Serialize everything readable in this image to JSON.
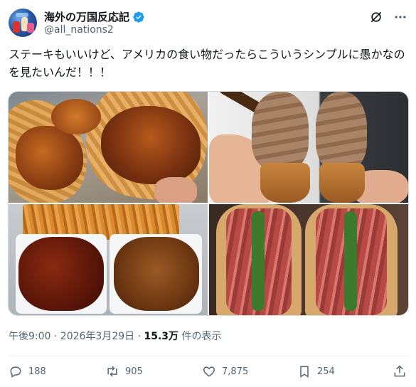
{
  "author": {
    "display_name": "海外の万国反応記",
    "handle": "@all_nations2",
    "verified": true
  },
  "tweet": {
    "text": "ステーキもいいけど、アメリカの食い物だったらこういうシンプルに愚かなのを見たいんだ！！！"
  },
  "media": {
    "count": 4
  },
  "meta": {
    "timestamp": "午後9:00 · 2026年3月29日 · ",
    "views_count": "15.3万",
    "views_label": " 件の表示"
  },
  "actions": {
    "replies": "188",
    "reposts": "905",
    "likes": "7,875",
    "bookmarks": "254"
  },
  "colors": {
    "verified_badge": "#1d9bf0",
    "secondary_text": "#536471",
    "primary_text": "#0f1419"
  },
  "icons": [
    "grok-icon",
    "more-icon",
    "reply-icon",
    "retweet-icon",
    "like-icon",
    "bookmark-icon",
    "share-icon",
    "verified-icon"
  ]
}
